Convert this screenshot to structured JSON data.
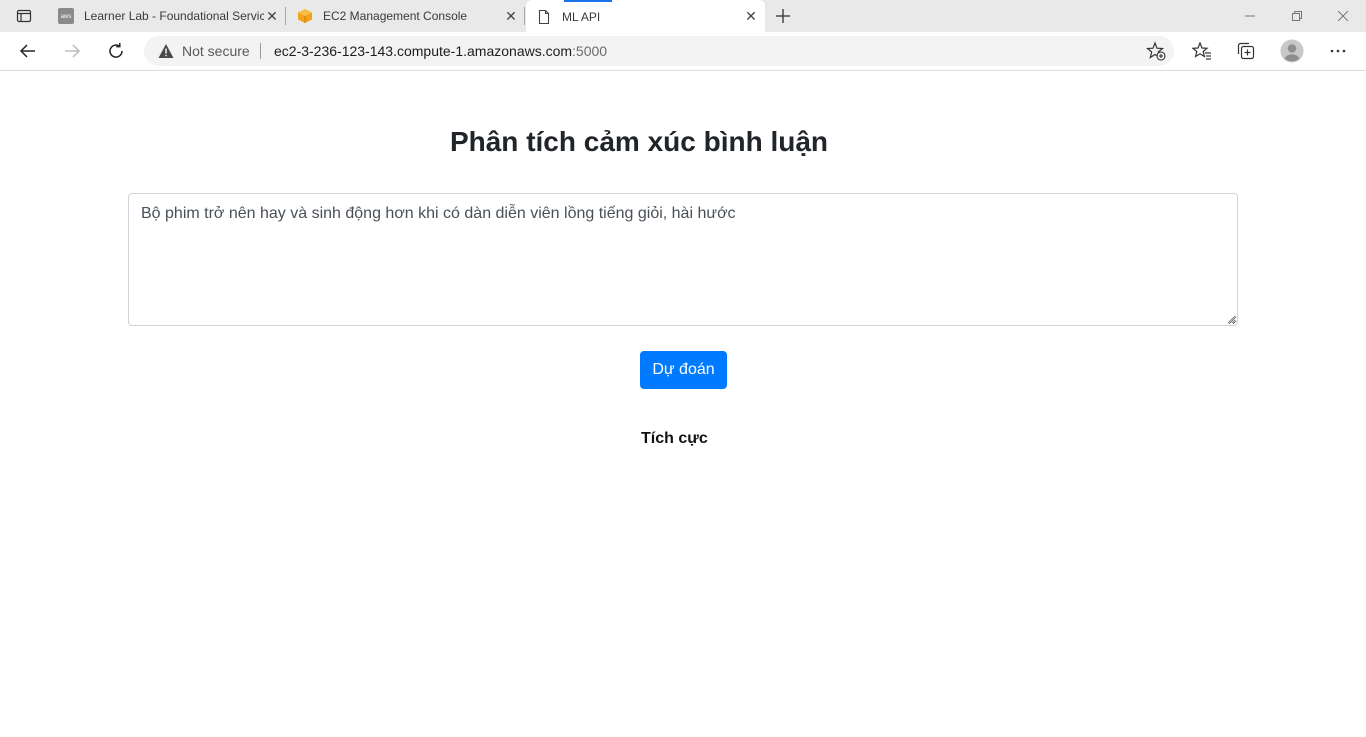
{
  "browser": {
    "tabs": [
      {
        "title": "Learner Lab - Foundational Servic",
        "icon": "aws-icon",
        "active": false
      },
      {
        "title": "EC2 Management Console",
        "icon": "aws-cube-icon",
        "active": false
      },
      {
        "title": "ML API",
        "icon": "page-icon",
        "active": true
      }
    ],
    "address": {
      "security_label": "Not secure",
      "url_host": "ec2-3-236-123-143.compute-1.amazonaws.com",
      "url_port": ":5000"
    }
  },
  "page": {
    "title": "Phân tích cảm xúc bình luận",
    "comment_text": "Bộ phim trở nên hay và sinh động hơn khi có dàn diễn viên lồng tiếng giỏi, hài hước",
    "predict_label": "Dự đoán",
    "result_text": "Tích cực"
  },
  "colors": {
    "accent": "#007bff",
    "heading": "#212529"
  }
}
